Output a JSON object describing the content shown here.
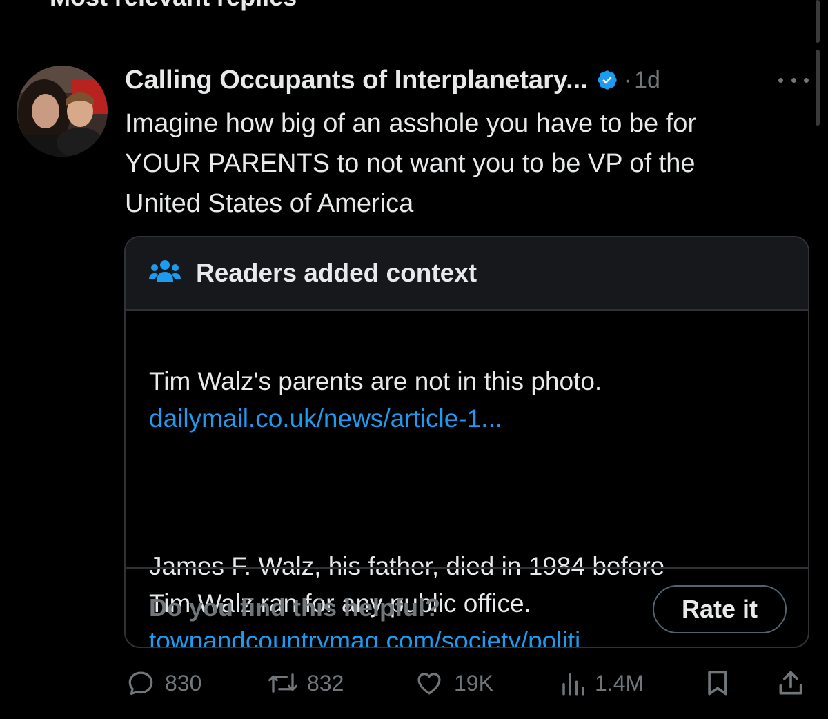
{
  "section": {
    "header": "Most relevant replies"
  },
  "tweet": {
    "display_name": "Calling Occupants of Interplanetary...",
    "separator": "·",
    "time": "1d",
    "text": "Imagine how big of an asshole you have to be for\nYOUR PARENTS to not want you to be VP of the\nUnited States of America"
  },
  "note": {
    "title": "Readers added context",
    "para1": "Tim Walz's parents are not in this photo.",
    "link1": "dailymail.co.uk/news/article-1...",
    "para2": "James F. Walz, his father, died in 1984 before\nTim Walz ran for any public office.",
    "link2": "townandcountrymag.com/society/politi...",
    "question": "Do you find this helpful?",
    "rate_label": "Rate it"
  },
  "actions": {
    "replies": "830",
    "reposts": "832",
    "likes": "19K",
    "views": "1.4M"
  },
  "icons": {
    "verified": "verified-badge-icon",
    "readers": "readers-group-icon",
    "reply": "reply-icon",
    "repost": "repost-icon",
    "like": "heart-icon",
    "views": "views-chart-icon",
    "bookmark": "bookmark-icon",
    "share": "share-icon",
    "more": "more-icon"
  },
  "colors": {
    "background": "#000000",
    "text": "#e7e9ea",
    "muted": "#71767b",
    "accent": "#1d9bf0",
    "border": "#2f3336"
  }
}
